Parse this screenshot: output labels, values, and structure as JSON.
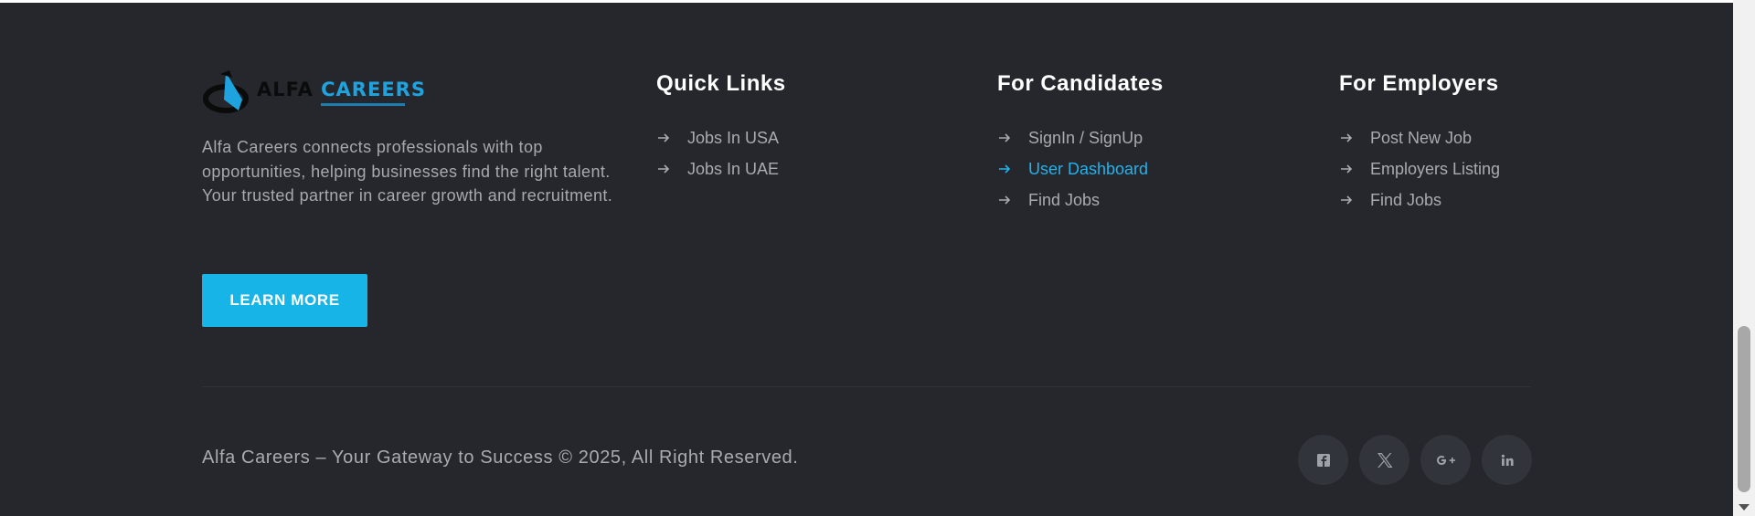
{
  "brand": {
    "logo_word_a": "ALFA",
    "logo_word_b": "CAREERS",
    "description": "Alfa Careers connects professionals with top opportunities, helping businesses find the right talent. Your trusted partner in career growth and recruitment.",
    "cta_label": "LEARN MORE"
  },
  "columns": [
    {
      "title": "Quick Links",
      "items": [
        "Jobs In USA",
        "Jobs In UAE"
      ]
    },
    {
      "title": "For Candidates",
      "items": [
        "SignIn / SignUp",
        "User Dashboard",
        "Find Jobs"
      ],
      "active_index": 1
    },
    {
      "title": "For Employers",
      "items": [
        "Post New Job",
        "Employers Listing",
        "Find Jobs"
      ]
    }
  ],
  "copyright": "Alfa Careers – Your Gateway to Success © 2025, All Right Reserved.",
  "social": [
    "facebook-icon",
    "x-icon",
    "google-plus-icon",
    "linkedin-icon"
  ],
  "colors": {
    "background": "#25272c",
    "accent": "#17b4e8",
    "heading": "#ffffff",
    "text": "#a9abb0"
  }
}
